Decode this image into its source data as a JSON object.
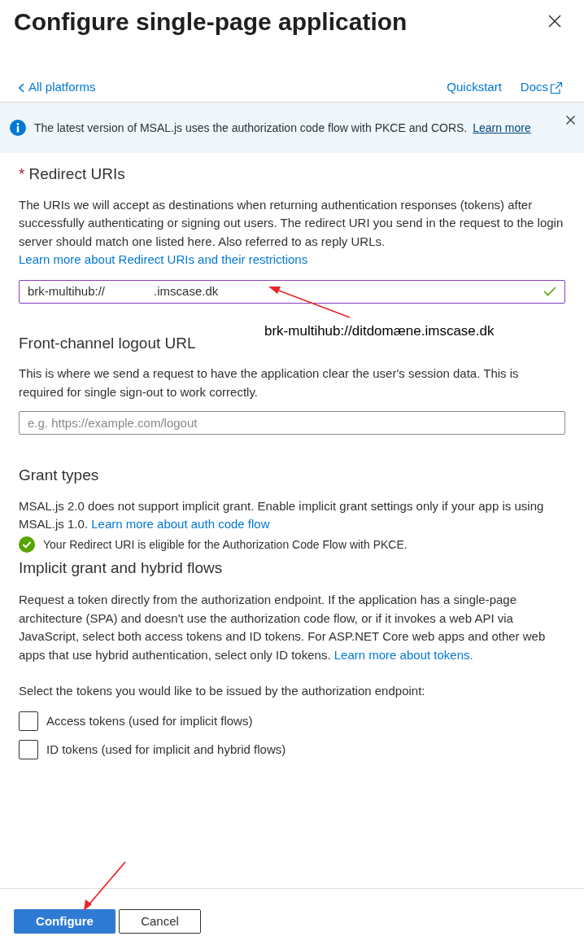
{
  "title": "Configure single-page application",
  "nav": {
    "back": "All platforms",
    "links": [
      {
        "label": "Quickstart",
        "kind": "plain"
      },
      {
        "label": "Docs",
        "kind": "external"
      }
    ]
  },
  "banner": {
    "text": "The latest version of MSAL.js uses the authorization code flow with PKCE and CORS.",
    "link": "Learn more"
  },
  "redirect": {
    "required_mark": "*",
    "heading": "Redirect URIs",
    "description": "The URIs we will accept as destinations when returning authentication responses (tokens) after successfully authenticating or signing out users. The redirect URI you send in the request to the login server should match one listed here. Also referred to as reply URLs.",
    "link": "Learn more about Redirect URIs and their restrictions",
    "value_start": "brk-multihub://",
    "value_end": ".imscase.dk",
    "valid": true
  },
  "annotation": "brk-multihub://ditdomæne.imscase.dk",
  "logout": {
    "heading": "Front-channel logout URL",
    "description": "This is where we send a request to have the application clear the user's session data. This is required for single sign-out to work correctly.",
    "placeholder": "e.g. https://example.com/logout"
  },
  "grant": {
    "heading": "Grant types",
    "description": "MSAL.js 2.0 does not support implicit grant. Enable implicit grant settings only if your app is using MSAL.js 1.0.",
    "link": "Learn more about auth code flow",
    "status": "Your Redirect URI is eligible for the Authorization Code Flow with PKCE."
  },
  "implicit": {
    "heading": "Implicit grant and hybrid flows",
    "description": "Request a token directly from the authorization endpoint. If the application has a single-page architecture (SPA) and doesn't use the authorization code flow, or if it invokes a web API via JavaScript, select both access tokens and ID tokens. For ASP.NET Core web apps and other web apps that use hybrid authentication, select only ID tokens.",
    "link": "Learn more about tokens.",
    "prompt": "Select the tokens you would like to be issued by the authorization endpoint:",
    "tokens": [
      {
        "label": "Access tokens (used for implicit flows)",
        "checked": false
      },
      {
        "label": "ID tokens (used for implicit and hybrid flows)",
        "checked": false
      }
    ]
  },
  "buttons": [
    {
      "label": "Configure",
      "kind": "primary"
    },
    {
      "label": "Cancel",
      "kind": "secondary"
    }
  ]
}
